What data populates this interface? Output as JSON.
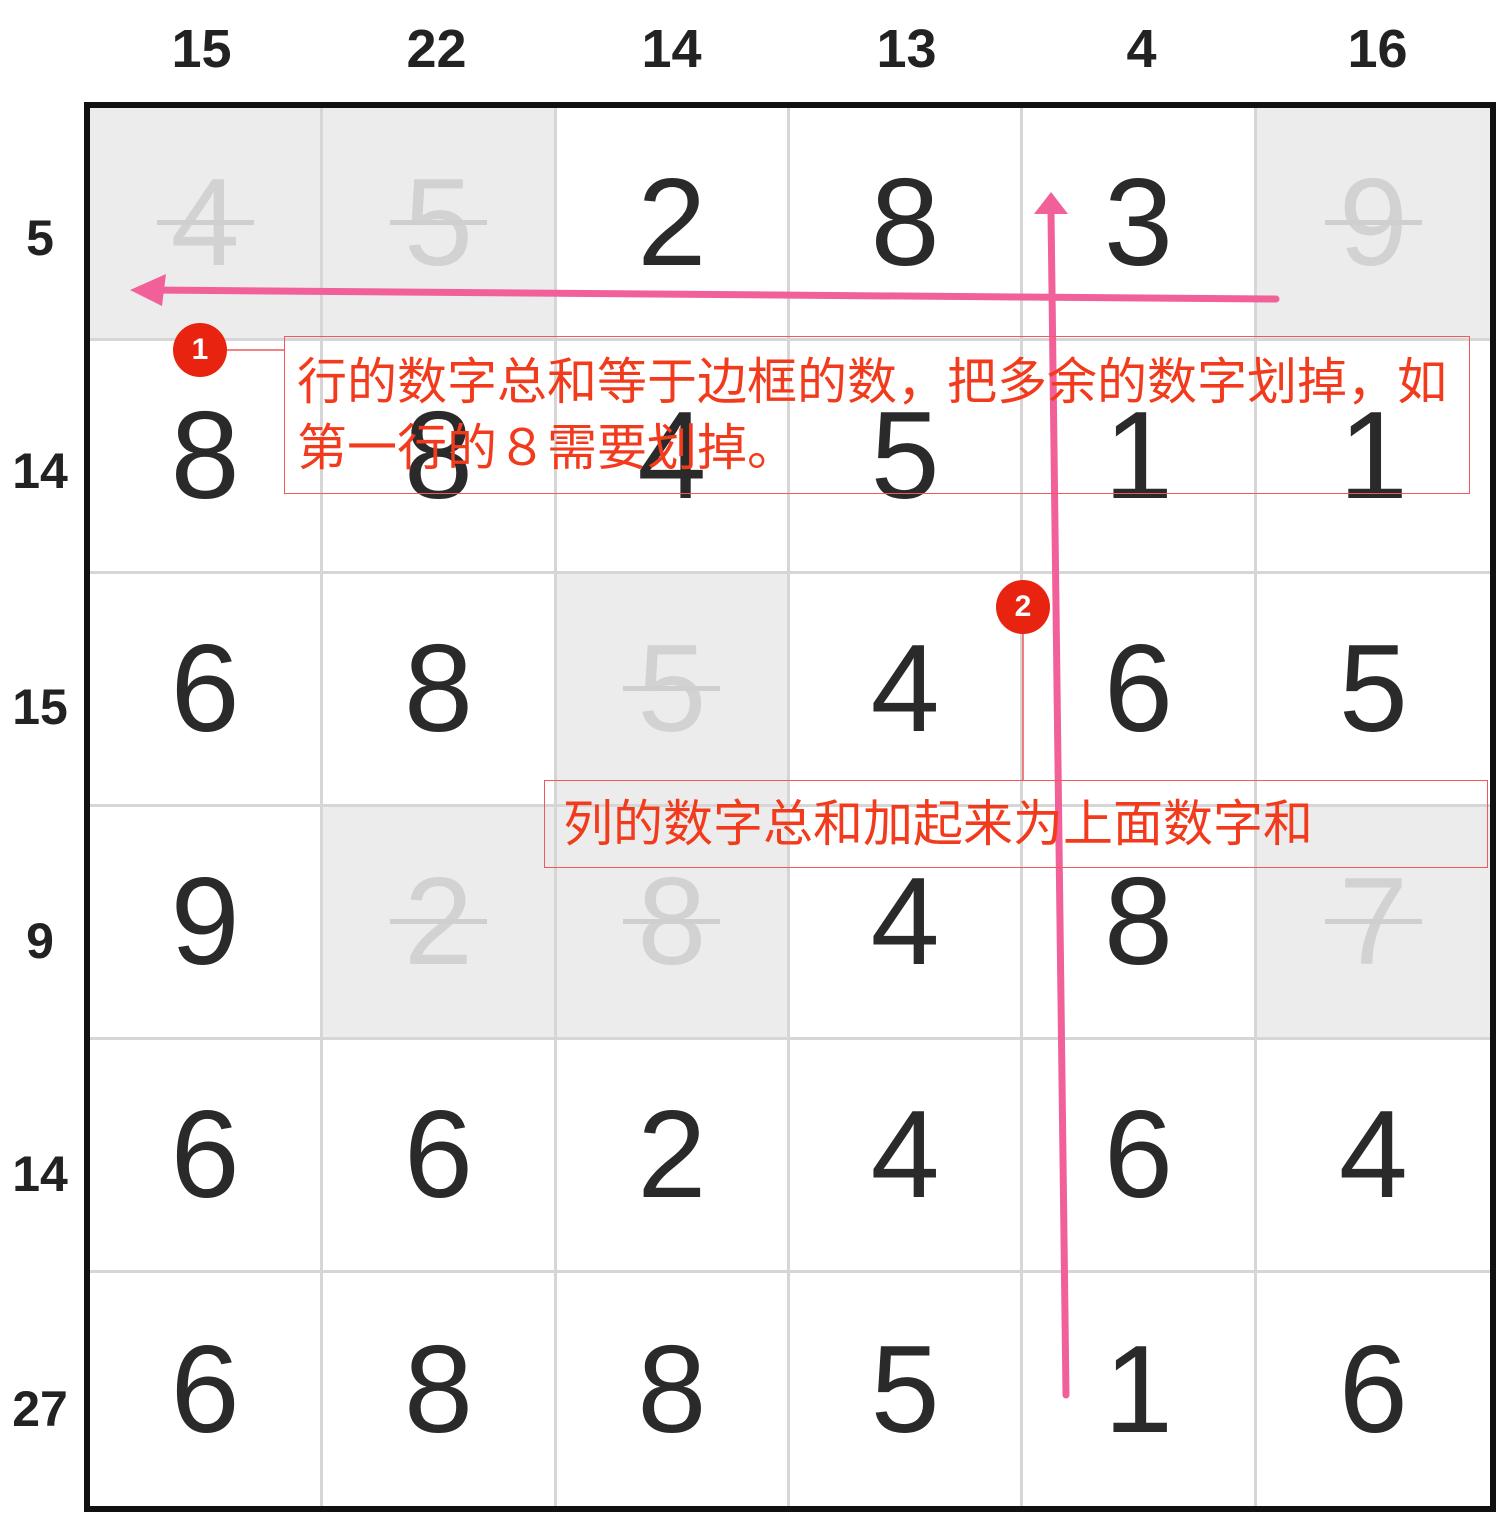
{
  "puzzle": {
    "column_clues": [
      "15",
      "22",
      "14",
      "13",
      "4",
      "16"
    ],
    "row_clues": [
      "5",
      "14",
      "15",
      "9",
      "14",
      "27"
    ],
    "grid": [
      [
        {
          "v": "4",
          "crossed": true
        },
        {
          "v": "5",
          "crossed": true
        },
        {
          "v": "2",
          "crossed": false
        },
        {
          "v": "8",
          "crossed": false
        },
        {
          "v": "3",
          "crossed": false
        },
        {
          "v": "9",
          "crossed": true
        }
      ],
      [
        {
          "v": "8",
          "crossed": false
        },
        {
          "v": "8",
          "crossed": false
        },
        {
          "v": "4",
          "crossed": false
        },
        {
          "v": "5",
          "crossed": false
        },
        {
          "v": "1",
          "crossed": false
        },
        {
          "v": "1",
          "crossed": false
        }
      ],
      [
        {
          "v": "6",
          "crossed": false
        },
        {
          "v": "8",
          "crossed": false
        },
        {
          "v": "5",
          "crossed": true
        },
        {
          "v": "4",
          "crossed": false
        },
        {
          "v": "6",
          "crossed": false
        },
        {
          "v": "5",
          "crossed": false
        }
      ],
      [
        {
          "v": "9",
          "crossed": false
        },
        {
          "v": "2",
          "crossed": true
        },
        {
          "v": "8",
          "crossed": true
        },
        {
          "v": "4",
          "crossed": false
        },
        {
          "v": "8",
          "crossed": false
        },
        {
          "v": "7",
          "crossed": true
        }
      ],
      [
        {
          "v": "6",
          "crossed": false
        },
        {
          "v": "6",
          "crossed": false
        },
        {
          "v": "2",
          "crossed": false
        },
        {
          "v": "4",
          "crossed": false
        },
        {
          "v": "6",
          "crossed": false
        },
        {
          "v": "4",
          "crossed": false
        }
      ],
      [
        {
          "v": "6",
          "crossed": false
        },
        {
          "v": "8",
          "crossed": false
        },
        {
          "v": "8",
          "crossed": false
        },
        {
          "v": "5",
          "crossed": false
        },
        {
          "v": "1",
          "crossed": false
        },
        {
          "v": "6",
          "crossed": false
        }
      ]
    ]
  },
  "annotations": {
    "badge1": "1",
    "note1": "行的数字总和等于边框的数，把多余的数字划掉，如第一行的８需要划掉。",
    "badge2": "2",
    "note2": "列的数字总和加起来为上面数字和"
  },
  "colors": {
    "arrow": "#f2609a",
    "annotation_text": "#f23b1c",
    "badge": "#e8230f",
    "crossed_cell_bg": "#ececec",
    "crossed_digit": "#d2d2d2",
    "digit": "#2a2a2a"
  }
}
